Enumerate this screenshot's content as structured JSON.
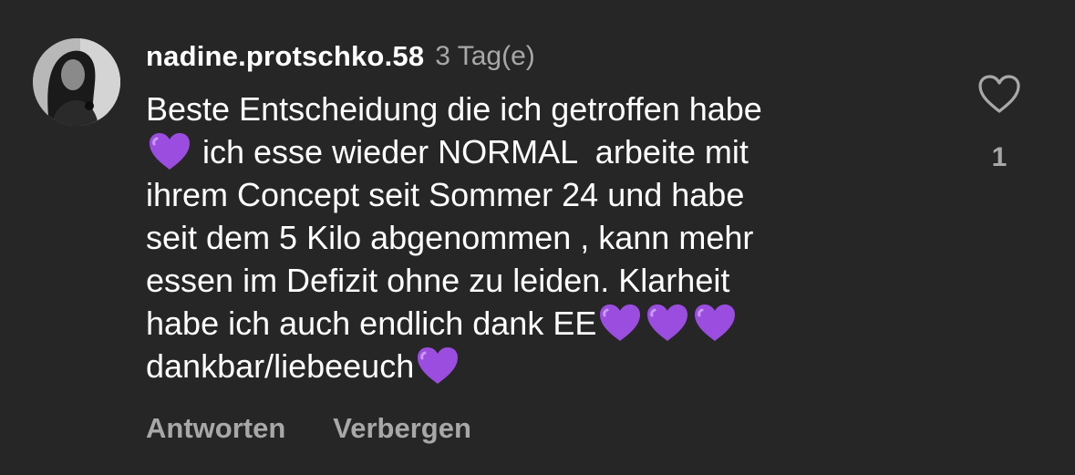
{
  "comment": {
    "username": "nadine.protschko.58",
    "timestamp": "3 Tag(e)",
    "body": {
      "line1": "Beste Entscheidung die ich getroffen habe",
      "line2": " ich esse wieder NORMAL  arbeite mit",
      "line3": "ihrem Concept seit Sommer 24 und habe",
      "line4": "seit dem 5 Kilo abgenommen , kann mehr",
      "line5": "essen im Defizit ohne zu leiden. Klarheit",
      "line6": "habe ich auch endlich dank EE",
      "line7": "dankbar/liebeeuch"
    },
    "emoji": {
      "name": "purple-heart-icon",
      "color": "#9b4de0"
    },
    "actions": {
      "reply_label": "Antworten",
      "hide_label": "Verbergen"
    },
    "likes": {
      "count": "1",
      "icon": "heart-outline-icon"
    }
  },
  "colors": {
    "background": "#262626",
    "primary_text": "#ffffff",
    "secondary_text": "#a8a8a8"
  }
}
